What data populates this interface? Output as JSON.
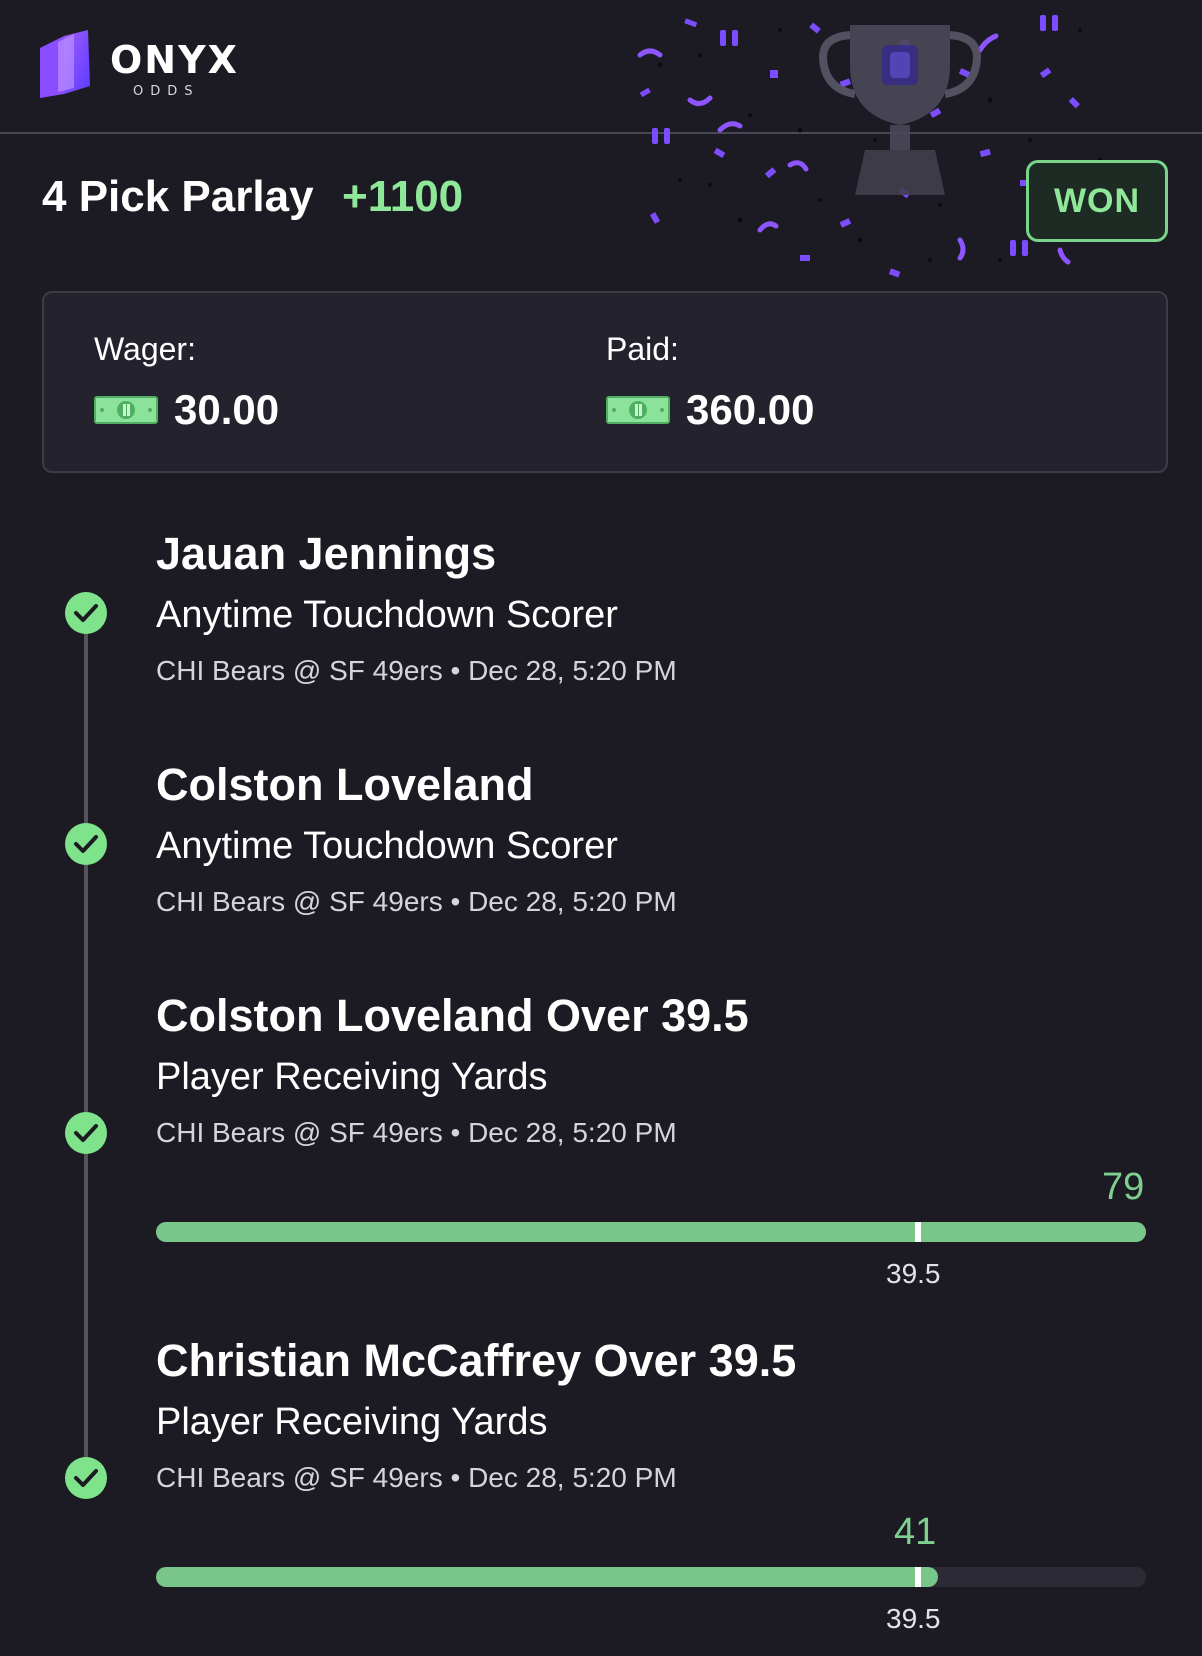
{
  "brand": {
    "name": "ONYX",
    "sub": "ODDS"
  },
  "bet": {
    "title": "4 Pick Parlay",
    "odds": "+1100",
    "status": "WON"
  },
  "wager": {
    "label": "Wager:",
    "amount": "30.00"
  },
  "paid": {
    "label": "Paid:",
    "amount": "360.00"
  },
  "colors": {
    "accent_green": "#7ac68a",
    "background": "#1c1b24",
    "confetti": "#7b4dff"
  },
  "picks": [
    {
      "title": "Jauan Jennings",
      "market": "Anytime Touchdown Scorer",
      "game": "CHI Bears @ SF 49ers • Dec 28, 5:20 PM",
      "status": "won"
    },
    {
      "title": "Colston Loveland",
      "market": "Anytime Touchdown Scorer",
      "game": "CHI Bears @ SF 49ers • Dec 28, 5:20 PM",
      "status": "won"
    },
    {
      "title": "Colston Loveland Over 39.5",
      "market": "Player Receiving Yards",
      "game": "CHI Bears @ SF 49ers • Dec 28, 5:20 PM",
      "status": "won",
      "progress": {
        "actual": "79",
        "line": "39.5",
        "fill_fraction": 1.0,
        "line_fraction": 0.77
      }
    },
    {
      "title": "Christian McCaffrey Over 39.5",
      "market": "Player Receiving Yards",
      "game": "CHI Bears @ SF 49ers • Dec 28, 5:20 PM",
      "status": "won",
      "progress": {
        "actual": "41",
        "line": "39.5",
        "fill_fraction": 0.79,
        "line_fraction": 0.77
      }
    }
  ]
}
